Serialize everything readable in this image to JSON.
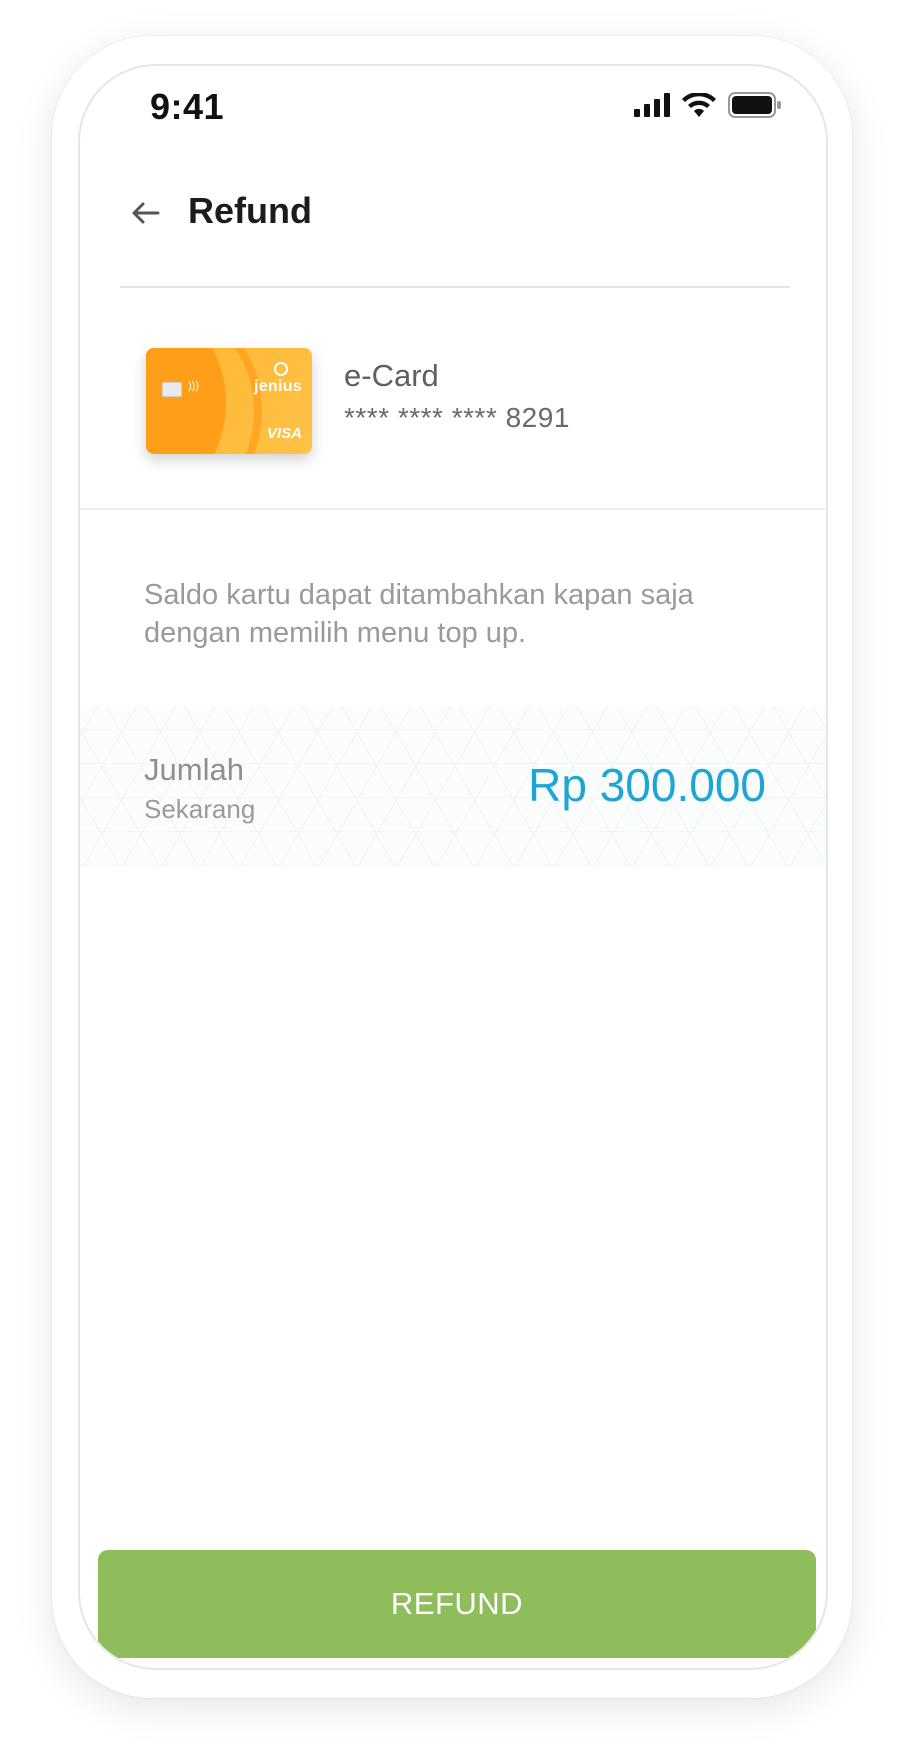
{
  "status_bar": {
    "time": "9:41",
    "icons": [
      "signal-icon",
      "wifi-icon",
      "battery-icon"
    ]
  },
  "header": {
    "title": "Refund",
    "back_icon": "arrow-left-icon"
  },
  "card": {
    "brand": "Jenius",
    "network": "VISA",
    "name": "e-Card",
    "number": "**** **** **** 8291"
  },
  "info": {
    "text": "Saldo kartu dapat ditambahkan kapan saja dengan memilih menu top up."
  },
  "amount": {
    "label": "Jumlah",
    "sublabel": "Sekarang",
    "value": "Rp 300.000"
  },
  "actions": {
    "refund_label": "REFUND"
  },
  "colors": {
    "accent_blue": "#1ea5d6",
    "button_green": "#8fbd5b",
    "card_orange": "#ffb52e"
  }
}
